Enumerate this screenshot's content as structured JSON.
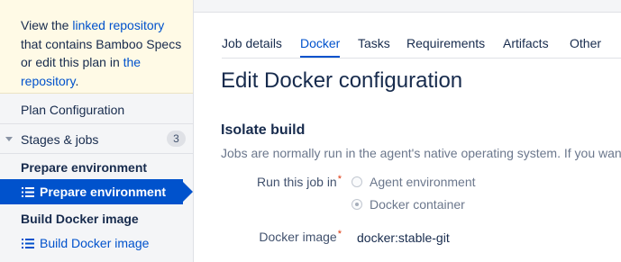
{
  "notice": {
    "text_1": "View the ",
    "link_1": "linked repository",
    "text_2": " that contains Bamboo Specs or edit this plan in ",
    "link_2": "the repository",
    "text_3": "."
  },
  "sidebar": {
    "plan_configuration": "Plan Configuration",
    "stages_label": "Stages & jobs",
    "stages_count": "3",
    "stages": [
      {
        "title": "Prepare environment",
        "job": "Prepare environment",
        "active": true
      },
      {
        "title": "Build Docker image",
        "job": "Build Docker image",
        "active": false
      }
    ]
  },
  "tabs": [
    {
      "label": "Job details",
      "active": false
    },
    {
      "label": "Docker",
      "active": true
    },
    {
      "label": "Tasks",
      "active": false
    },
    {
      "label": "Requirements",
      "active": false
    },
    {
      "label": "Artifacts",
      "active": false
    },
    {
      "label": "Other",
      "active": false
    }
  ],
  "main": {
    "title": "Edit Docker configuration",
    "section_title": "Isolate build",
    "description": "Jobs are normally run in the agent's native operating system. If you want",
    "run_job_label": "Run this job in",
    "run_options": [
      {
        "label": "Agent environment",
        "checked": false
      },
      {
        "label": "Docker container",
        "checked": true
      }
    ],
    "docker_image_label": "Docker image",
    "docker_image_value": "docker:stable-git",
    "required_marker": "*"
  },
  "colors": {
    "accent": "#0052cc",
    "notice_bg": "#fffae6",
    "sidebar_bg": "#f4f5f7",
    "required": "#de350b"
  },
  "icons": {
    "job_icon": "list-icon",
    "stages_toggle": "chevron-down-icon"
  }
}
